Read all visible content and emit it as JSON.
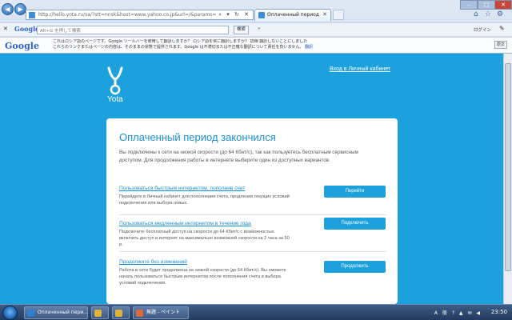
{
  "browser": {
    "address": {
      "url": "http://hello.yota.ru/sa/?stt=nnsk&host=www.yahoo.co.jp&url=/&params="
    },
    "tab": {
      "title": "Оплаченный период зак..."
    },
    "google_toolbar": {
      "logo": "Google",
      "search_placeholder": "Alt+G を押して検索",
      "search_button": "検索",
      "more_label": "»",
      "login_label": "ログイン"
    },
    "translate_bar": {
      "logo": "Google",
      "line1": "これはロシア語のページです。Google ツールバーを使用して翻訳しますか？ ロシア語を常に翻訳しますか？ 詳細 翻訳しないことにしました",
      "line2": "これらのリンクまたはページの内容は、そのままの状態で提供されます。Google は不適切または不正確な翻訳について責任を負いません。",
      "link": "翻訳",
      "original_button": "原文"
    }
  },
  "page": {
    "logo_text": "Yota",
    "login_link": "Вход в Личный кабинет",
    "heading": "Оплаченный период закончился",
    "intro": "Вы подключены к сети на низкой скорости (до 64 Кбит/с), так как пользуетесь бесплатным сервисным доступом. Для продолжения работы в интернете выберите один из доступных вариантов.",
    "options": [
      {
        "title": "Пользоваться быстрым интернетом, пополнив счет",
        "desc": "Перейдите в Личный кабинет для пополнения счета, продления текущих условий подключения или выбора новых.",
        "button": "Перейти"
      },
      {
        "title": "Пользоваться медленным интернетом в течение года",
        "desc": "Подключите бесплатный доступ на скорости до 64 Кбит/с с возможностью включить доступ в интернет на максимально возможной скорости на 2 часа за 50 р.",
        "button": "Подключить"
      },
      {
        "title": "Продолжите без изменений",
        "desc": "Работа в сети будет продолжена на низкой скорости (до 64 Кбит/с). Вы сможете начать пользоваться быстрым интернетом после пополнения счета и выбора условий подключения.",
        "button": "Продолжить"
      }
    ]
  },
  "taskbar": {
    "tasks": [
      {
        "label": "Оплаченный пери...",
        "color": "#2f7fd0"
      },
      {
        "label": "",
        "color": "#e1b23a"
      },
      {
        "label": "",
        "color": "#e1b23a"
      },
      {
        "label": "無題 - ペイント",
        "color": "#d96b3b"
      }
    ],
    "tray_text": "A 般 ? ▲ ✉ ◀",
    "clock": "23:50"
  },
  "colors": {
    "accent": "#1da1dc",
    "link": "#1a8fd0"
  }
}
